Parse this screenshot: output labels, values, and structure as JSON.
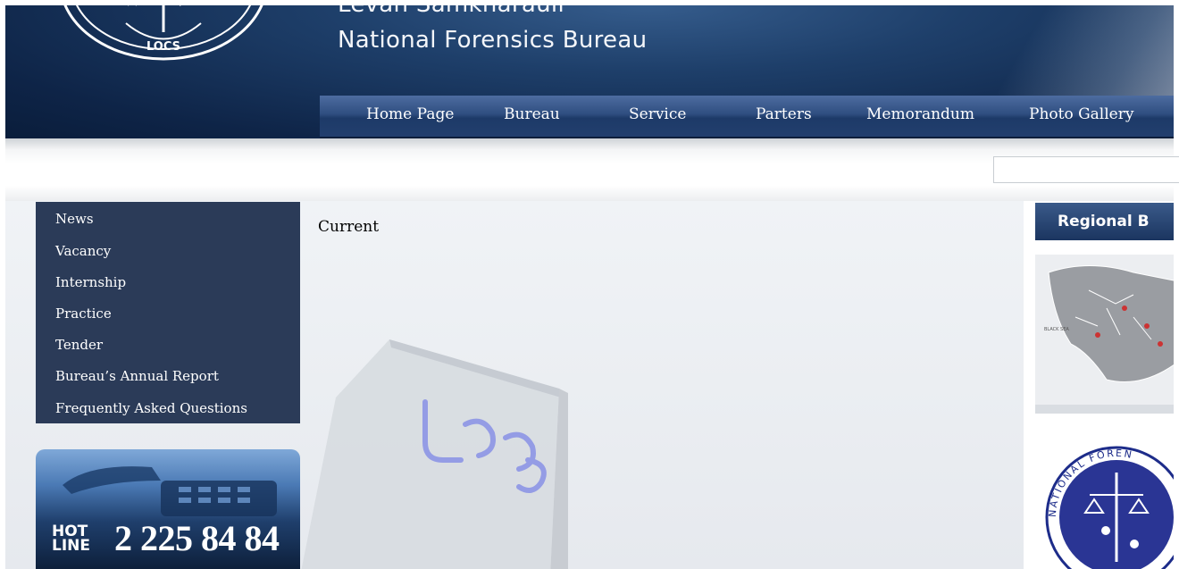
{
  "header": {
    "title_line1": "Levan Samkharauli",
    "title_line2": "National Forensics Bureau",
    "logo_text": "LOCS"
  },
  "nav": {
    "items": [
      "Home Page",
      "Bureau",
      "Service",
      "Parters",
      "Memorandum",
      "Photo Gallery"
    ]
  },
  "search": {
    "placeholder": ""
  },
  "sidebar": {
    "items": [
      "News",
      "Vacancy",
      "Internship",
      "Practice",
      "Tender",
      "Bureau’s Annual Report",
      "Frequently Asked Questions"
    ]
  },
  "hotline": {
    "label_line1": "HOT",
    "label_line2": "LINE",
    "number": "2 225 84 84"
  },
  "main": {
    "heading": "Current"
  },
  "right": {
    "regional_title": "Regional B",
    "map_label": "BLACK SEA",
    "seal_text": "NATIONAL FOREN"
  },
  "colors": {
    "header_dark": "#0e2447",
    "nav_blue": "#2f4e80",
    "menu_bg": "#2b3b58"
  }
}
